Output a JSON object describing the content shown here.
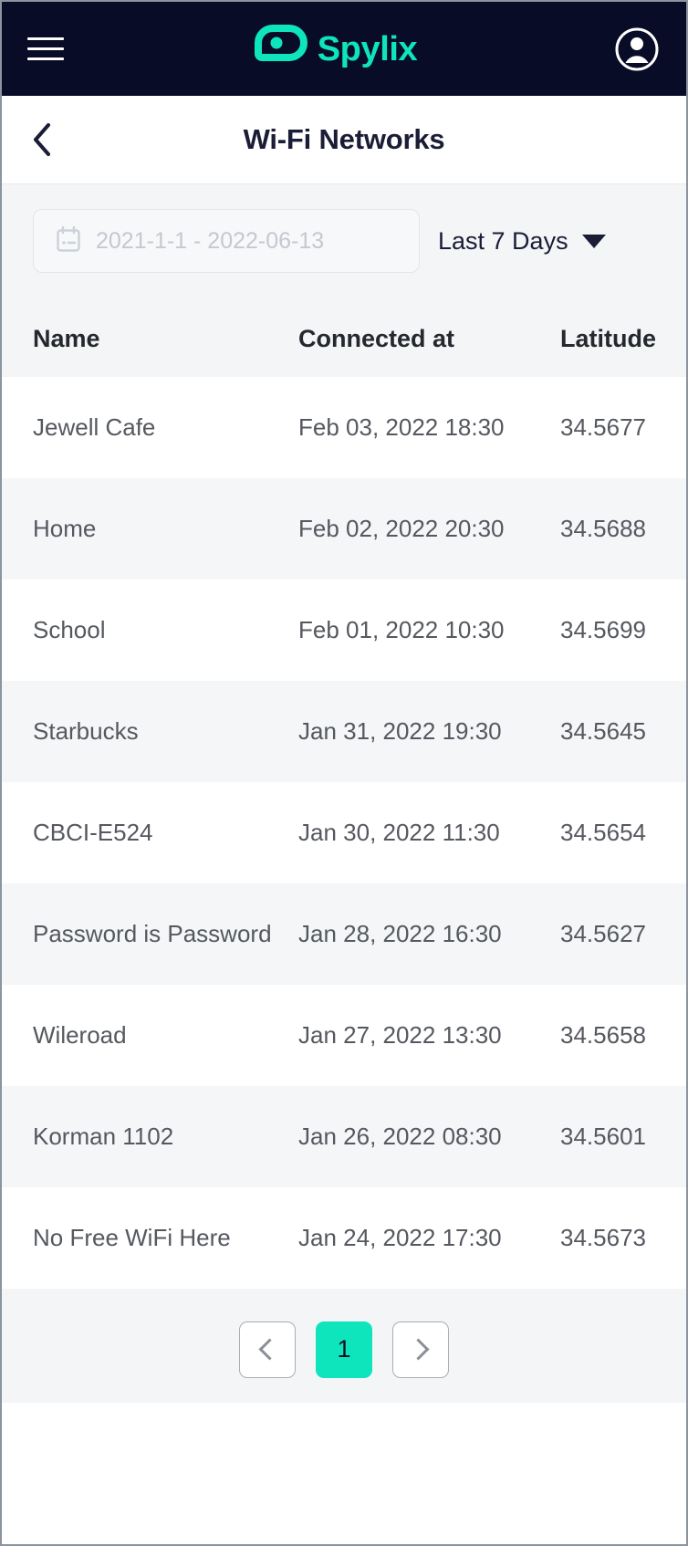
{
  "appbar": {
    "menu_icon": "hamburger-menu-icon",
    "brand_name": "Spylix",
    "logo_icon": "spylix-eye-logo-icon",
    "account_icon": "user-account-icon",
    "bg_color": "#080c26",
    "accent_color": "#0fe5bd"
  },
  "titlebar": {
    "back_icon": "chevron-left-icon",
    "title": "Wi-Fi Networks"
  },
  "filters": {
    "date_range": {
      "icon": "calendar-icon",
      "placeholder": "2021-1-1 - 2022-06-13",
      "value": ""
    },
    "range_select": {
      "selected": "Last 7 Days",
      "caret_icon": "caret-down-icon"
    }
  },
  "table": {
    "columns": [
      "Name",
      "Connected at",
      "Latitude"
    ],
    "rows": [
      {
        "name": "Jewell Cafe",
        "connected_at": "Feb 03, 2022 18:30",
        "latitude": "34.5677"
      },
      {
        "name": "Home",
        "connected_at": "Feb 02, 2022 20:30",
        "latitude": "34.5688"
      },
      {
        "name": "School",
        "connected_at": "Feb 01, 2022 10:30",
        "latitude": "34.5699"
      },
      {
        "name": "Starbucks",
        "connected_at": "Jan 31, 2022 19:30",
        "latitude": "34.5645"
      },
      {
        "name": "CBCI-E524",
        "connected_at": "Jan 30, 2022 11:30",
        "latitude": "34.5654"
      },
      {
        "name": "Password is Password",
        "connected_at": "Jan 28, 2022 16:30",
        "latitude": "34.5627"
      },
      {
        "name": "Wileroad",
        "connected_at": "Jan 27, 2022 13:30",
        "latitude": "34.5658"
      },
      {
        "name": "Korman 1102",
        "connected_at": "Jan 26, 2022 08:30",
        "latitude": "34.5601"
      },
      {
        "name": "No Free WiFi Here",
        "connected_at": "Jan 24, 2022 17:30",
        "latitude": "34.5673"
      }
    ]
  },
  "pagination": {
    "prev_icon": "chevron-left-icon",
    "next_icon": "chevron-right-icon",
    "current_page": "1",
    "active_color": "#0fe5bd"
  }
}
